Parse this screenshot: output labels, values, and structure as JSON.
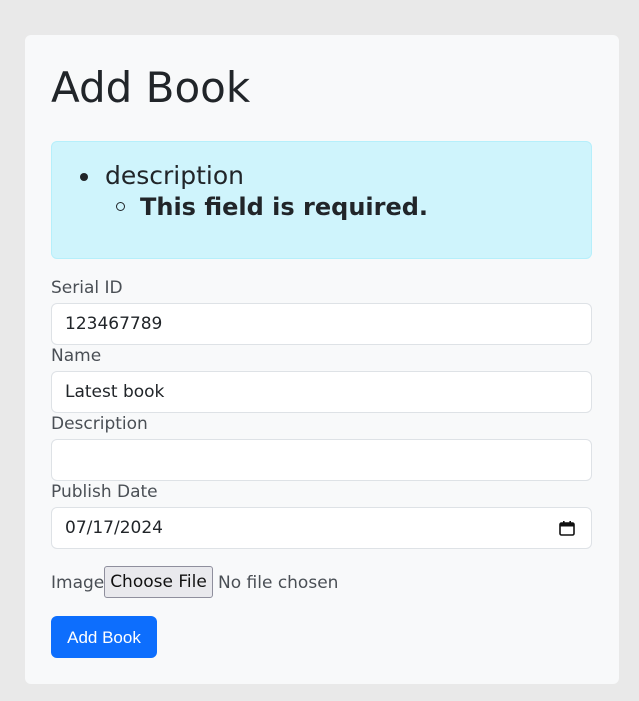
{
  "page_title": "Add Book",
  "errors": {
    "field": "description",
    "message": "This field is required."
  },
  "form": {
    "serial_id": {
      "label": "Serial ID",
      "value": "123467789"
    },
    "name": {
      "label": "Name",
      "value": "Latest book"
    },
    "description": {
      "label": "Description",
      "value": ""
    },
    "publish_date": {
      "label": "Publish Date",
      "value": "07/17/2024"
    },
    "image": {
      "label": "Image",
      "button": "Choose File",
      "status": "No file chosen"
    },
    "submit_label": "Add Book"
  },
  "colors": {
    "alert_bg": "#cff4fc",
    "primary": "#0d6efd"
  }
}
